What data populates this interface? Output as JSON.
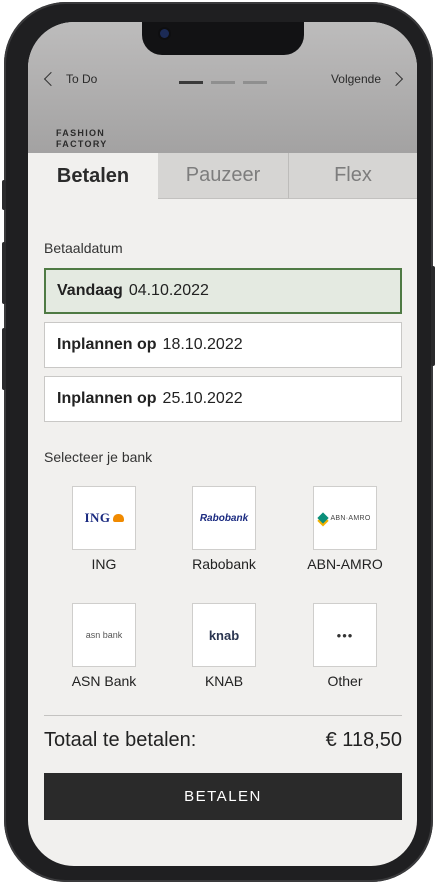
{
  "nav": {
    "back_label": "To Do",
    "next_label": "Volgende",
    "progress": {
      "steps": 3,
      "active_step": 1
    }
  },
  "logo": {
    "line1": "FASHION",
    "line2": "FACTORY"
  },
  "tabs": [
    {
      "label": "Betalen",
      "active": true
    },
    {
      "label": "Pauzeer",
      "active": false
    },
    {
      "label": "Flex",
      "active": false
    }
  ],
  "payment_date": {
    "label": "Betaaldatum",
    "options": [
      {
        "key": "Vandaag",
        "date": "04.10.2022",
        "selected": true
      },
      {
        "key": "Inplannen op",
        "date": "18.10.2022",
        "selected": false
      },
      {
        "key": "Inplannen op",
        "date": "25.10.2022",
        "selected": false
      }
    ]
  },
  "bank": {
    "label": "Selecteer je bank",
    "options": [
      {
        "name": "ING",
        "logo_text": "ING"
      },
      {
        "name": "Rabobank",
        "logo_text": "Rabobank"
      },
      {
        "name": "ABN-AMRO",
        "logo_text": "ABN·AMRO"
      },
      {
        "name": "ASN Bank",
        "logo_text": "asn bank"
      },
      {
        "name": "KNAB",
        "logo_text": "knab"
      },
      {
        "name": "Other",
        "logo_text": "•••"
      }
    ]
  },
  "total": {
    "label": "Totaal te betalen:",
    "value": "€ 118,50"
  },
  "pay_button": {
    "label": "BETALEN"
  },
  "colors": {
    "selected_border": "#4f7a44",
    "selected_fill": "#e4eae1",
    "button": "#2a2a2a",
    "background": "#f1f0ee"
  }
}
